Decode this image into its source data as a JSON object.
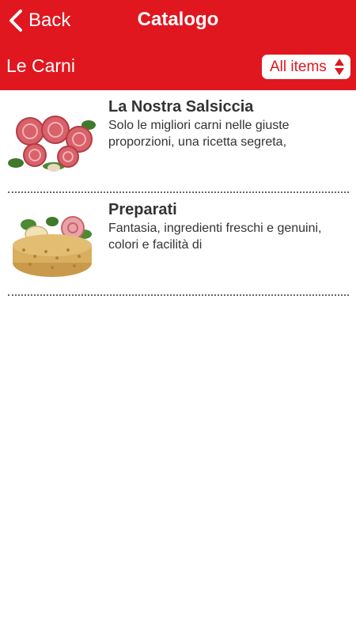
{
  "navbar": {
    "back_label": "Back",
    "title": "Catalogo",
    "background_color": "#e0171f",
    "back_icon": "chevron-left-icon"
  },
  "category_bar": {
    "title": "Le Carni",
    "filter": {
      "selected": "All items",
      "icon": "up-down-arrows-icon"
    }
  },
  "items": [
    {
      "title": "La Nostra Salsiccia",
      "description": "Solo le migliori carni nelle giuste proporzioni, una ricetta segreta,",
      "image": "sausage-photo"
    },
    {
      "title": "Preparati",
      "description": "Fantasia, ingredienti freschi e genuini, colori e facilità di",
      "image": "prepared-dish-photo"
    }
  ]
}
